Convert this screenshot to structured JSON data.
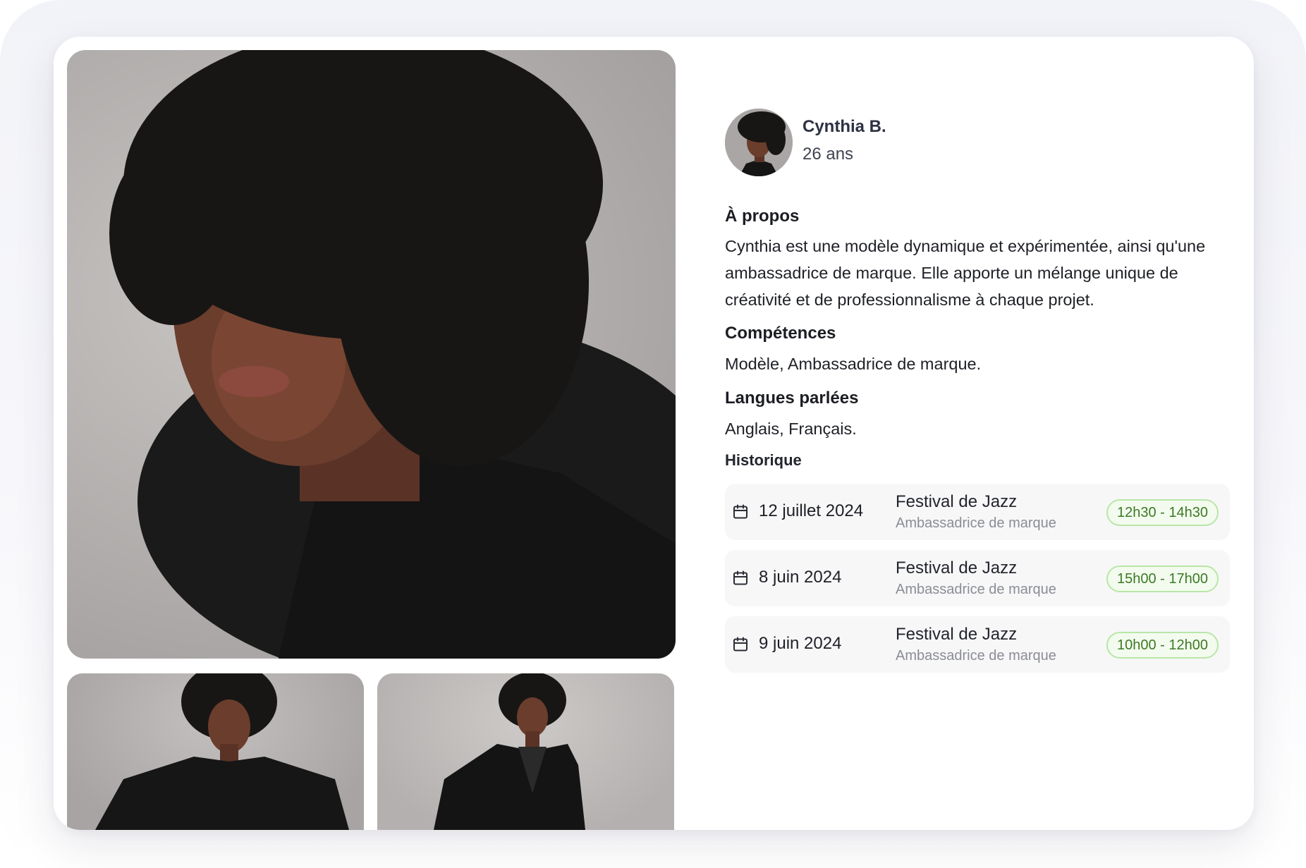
{
  "profile": {
    "name": "Cynthia B.",
    "age": "26 ans"
  },
  "about": {
    "title": "À propos",
    "text": "Cynthia est une modèle dynamique et expérimentée, ainsi qu'une ambassadrice de marque. Elle apporte un mélange unique de créativité et de professionnalisme à chaque projet."
  },
  "skills": {
    "title": "Compétences",
    "text": "Modèle, Ambassadrice de marque."
  },
  "languages": {
    "title": "Langues parlées",
    "text": "Anglais, Français."
  },
  "history": {
    "title": "Historique",
    "items": [
      {
        "date": "12 juillet 2024",
        "event": "Festival de Jazz",
        "role": "Ambassadrice de marque",
        "time": "12h30 - 14h30"
      },
      {
        "date": "8 juin 2024",
        "event": "Festival de Jazz",
        "role": "Ambassadrice de marque",
        "time": "15h00 - 17h00"
      },
      {
        "date": "9 juin 2024",
        "event": "Festival de Jazz",
        "role": "Ambassadrice de marque",
        "time": "10h00 - 12h00"
      }
    ]
  },
  "icons": {
    "calendar": "calendar-icon"
  },
  "colors": {
    "badge_border": "#b9e6a6",
    "badge_text": "#3d7a24",
    "row_background": "#f7f7f8"
  }
}
